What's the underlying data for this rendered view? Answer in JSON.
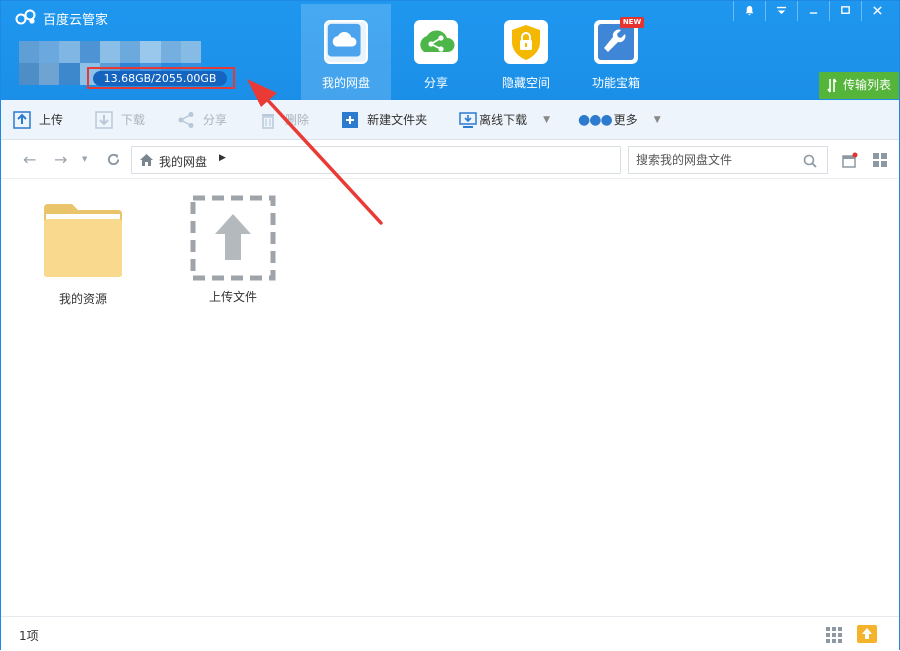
{
  "app": {
    "title": "百度云管家",
    "quota": "13.68GB/2055.00GB"
  },
  "nav": {
    "tabs": [
      {
        "label": "我的网盘",
        "icon": "cloud-icon",
        "active": true
      },
      {
        "label": "分享",
        "icon": "share-icon",
        "active": false
      },
      {
        "label": "隐藏空间",
        "icon": "lock-icon",
        "active": false
      },
      {
        "label": "功能宝箱",
        "icon": "wrench-icon",
        "active": false
      }
    ],
    "new_badge": "NEW"
  },
  "window_controls": [
    "bell-icon",
    "menu-icon",
    "minimize-icon",
    "maximize-icon",
    "close-icon"
  ],
  "transfer_list": "传输列表",
  "toolbar": {
    "upload": "上传",
    "download": "下载",
    "share": "分享",
    "delete": "删除",
    "new_folder": "新建文件夹",
    "offline_download": "离线下载",
    "more": "更多"
  },
  "address": {
    "path": "我的网盘",
    "search_placeholder": "搜索我的网盘文件"
  },
  "files": [
    {
      "name": "我的资源",
      "type": "folder"
    },
    {
      "name": "上传文件",
      "type": "upload-placeholder"
    }
  ],
  "status": {
    "count": "1项"
  },
  "colors": {
    "header_blue": "#1b8fe8",
    "accent_green": "#55b53a",
    "highlight_red": "#e53935",
    "folder_yellow": "#f8d98e"
  }
}
